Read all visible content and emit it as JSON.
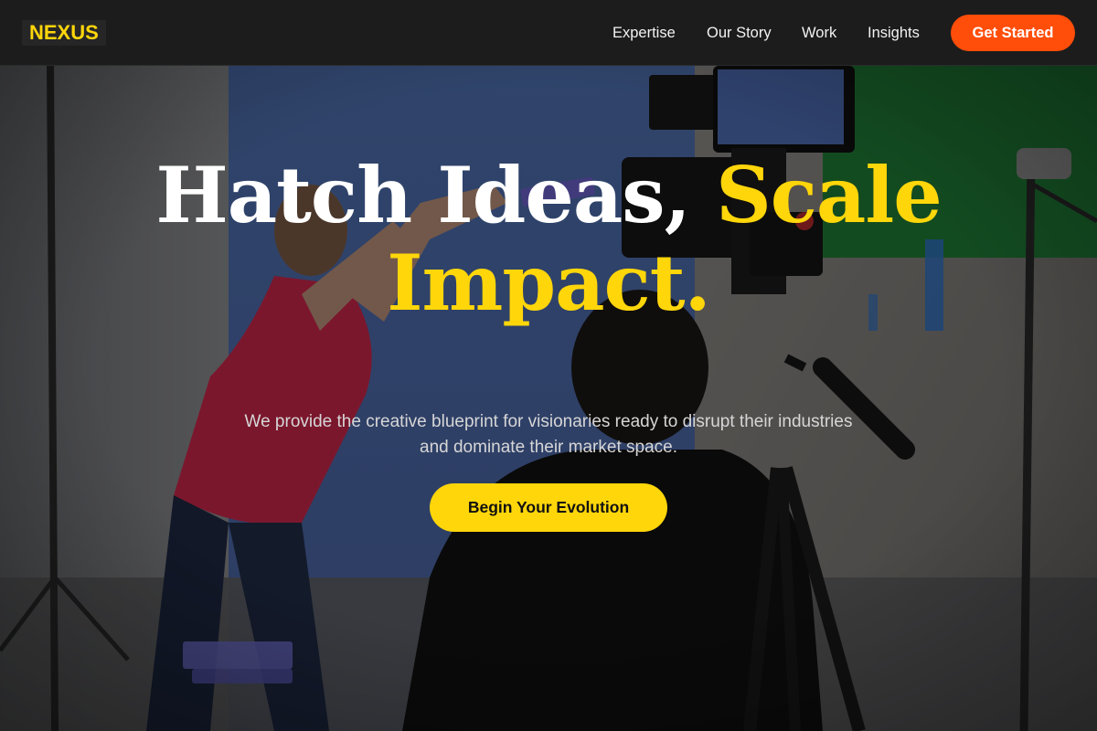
{
  "brand": {
    "logo_text": "NEXUS"
  },
  "nav": {
    "links": [
      "Expertise",
      "Our Story",
      "Work",
      "Insights"
    ],
    "cta_label": "Get Started"
  },
  "hero": {
    "headline_white": "Hatch Ideas,",
    "headline_accent_1": "Scale",
    "headline_accent_2": "Impact.",
    "subtitle": "We provide the creative blueprint for visionaries ready to disrupt their industries and dominate their market space.",
    "cta_label": "Begin Your Evolution"
  },
  "colors": {
    "accent_yellow": "#ffd60a",
    "accent_orange": "#ff4d0a",
    "header_bg": "#1c1c1c"
  }
}
